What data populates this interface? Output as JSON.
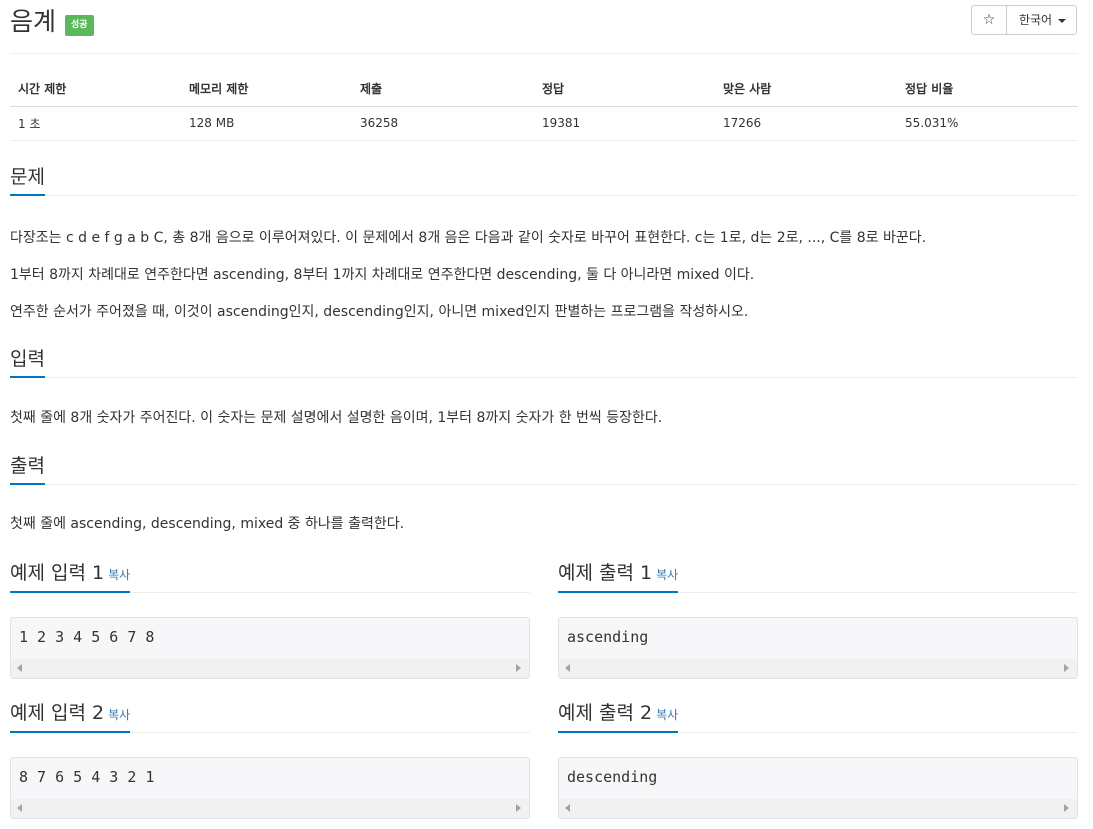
{
  "header": {
    "title": "음계",
    "badge": "성공",
    "star_label": "☆",
    "language_label": "한국어",
    "colors": {
      "badge_bg": "#5cb85c",
      "accent": "#0076c0",
      "link": "#337ab7"
    }
  },
  "info_table": {
    "headers": [
      "시간 제한",
      "메모리 제한",
      "제출",
      "정답",
      "맞은 사람",
      "정답 비율"
    ],
    "values": [
      "1 초",
      "128 MB",
      "36258",
      "19381",
      "17266",
      "55.031%"
    ]
  },
  "sections": {
    "problem": {
      "title": "문제",
      "paragraphs": [
        "다장조는 c d e f g a b C, 총 8개 음으로 이루어져있다. 이 문제에서 8개 음은 다음과 같이 숫자로 바꾸어 표현한다. c는 1로, d는 2로, ..., C를 8로 바꾼다.",
        "1부터 8까지 차례대로 연주한다면 ascending, 8부터 1까지 차례대로 연주한다면 descending, 둘 다 아니라면 mixed 이다.",
        "연주한 순서가 주어졌을 때, 이것이 ascending인지, descending인지, 아니면 mixed인지 판별하는 프로그램을 작성하시오."
      ]
    },
    "input": {
      "title": "입력",
      "paragraphs": [
        "첫째 줄에 8개 숫자가 주어진다. 이 숫자는 문제 설명에서 설명한 음이며, 1부터 8까지 숫자가 한 번씩 등장한다."
      ]
    },
    "output": {
      "title": "출력",
      "paragraphs": [
        "첫째 줄에 ascending, descending, mixed 중 하나를 출력한다."
      ]
    }
  },
  "samples": [
    {
      "title": "예제 입력 1",
      "copy_label": "복사",
      "content": "1 2 3 4 5 6 7 8"
    },
    {
      "title": "예제 출력 1",
      "copy_label": "복사",
      "content": "ascending"
    },
    {
      "title": "예제 입력 2",
      "copy_label": "복사",
      "content": "8 7 6 5 4 3 2 1"
    },
    {
      "title": "예제 출력 2",
      "copy_label": "복사",
      "content": "descending"
    }
  ]
}
